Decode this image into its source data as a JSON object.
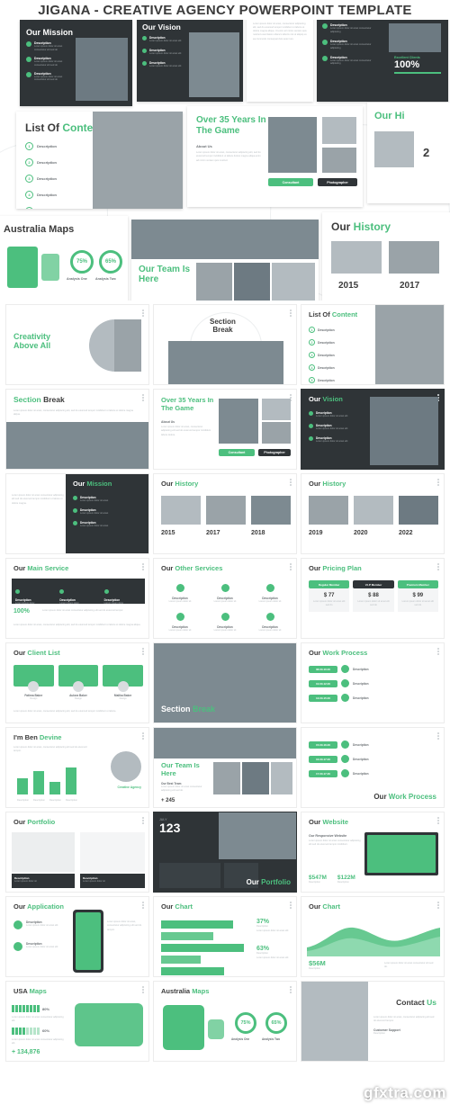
{
  "banner": {
    "title": "JIGANA - CREATIVE AGENCY POWERPOINT TEMPLATE"
  },
  "watermark": "gfxtra.com",
  "hero": {
    "slides": [
      {
        "title_plain": "Our ",
        "title_green": "Mission",
        "desc_label": "Description"
      },
      {
        "title_plain": "Our ",
        "title_green": "Vision",
        "desc_label": "Description"
      },
      {
        "title_plain": "Description",
        "stat_label": "Excellent Clients",
        "stat_value": "100%"
      },
      {
        "title_plain": "List Of ",
        "title_green": "Content",
        "desc_label": "Description"
      },
      {
        "title_plain": "Over 35 Years In",
        "title_line2": "The Game",
        "about_label": "About Us",
        "tag1": "Consultant",
        "tag2": "Photographer"
      },
      {
        "title_plain": "Our Hi",
        "year": "2"
      },
      {
        "title_plain": "Australia Maps",
        "ring1": "75%",
        "ring1_label": "Analysis One",
        "ring2": "65%",
        "ring2_label": "Analysis Two"
      },
      {
        "title_plain": "Our Team Is",
        "title_line2": "Here"
      },
      {
        "title_plain": "Our ",
        "title_green": "History",
        "year1": "2015",
        "year2": "2017"
      }
    ]
  },
  "grid": {
    "slides": [
      {
        "id": "creativity-above-all",
        "title": "Creativity",
        "title2": "Above All",
        "style": "light-green-title"
      },
      {
        "id": "section-break-1",
        "title": "Section",
        "title2": "Break",
        "style": "centered"
      },
      {
        "id": "list-of-content-1",
        "title": "List Of ",
        "title_green": "Content",
        "items": [
          "Description",
          "Description",
          "Description",
          "Description",
          "Description"
        ]
      },
      {
        "id": "section-break-2",
        "title": "Section ",
        "title_green": "Break"
      },
      {
        "id": "over-35-years",
        "title": "Over 35 Years In",
        "title2": "The Game",
        "about_label": "About Us",
        "tag1": "Consultant",
        "tag2": "Photographer"
      },
      {
        "id": "our-vision",
        "title": "Our ",
        "title_green": "Vision",
        "desc_label": "Description"
      },
      {
        "id": "our-mission",
        "title": "Our ",
        "title_green": "Mission",
        "desc_label": "Description"
      },
      {
        "id": "our-history-1",
        "title": "Our ",
        "title_green": "History",
        "years": [
          "2015",
          "2017",
          "2018"
        ]
      },
      {
        "id": "our-history-2",
        "title": "Our ",
        "title_green": "History",
        "years": [
          "2019",
          "2020",
          "2022"
        ]
      },
      {
        "id": "our-main-service",
        "title": "Our ",
        "title_green": "Main Service",
        "stat": "100%",
        "cols": [
          "Description",
          "Description",
          "Description"
        ]
      },
      {
        "id": "our-other-services",
        "title": "Our ",
        "title_green": "Other Services",
        "items": [
          "Description",
          "Description",
          "Description",
          "Description",
          "Description",
          "Description"
        ]
      },
      {
        "id": "our-pricing-plan",
        "title": "Our ",
        "title_green": "Pricing Plan",
        "plans": [
          {
            "name": "Regular Member",
            "price": "$ 77"
          },
          {
            "name": "V.I.P Member",
            "price": "$ 88"
          },
          {
            "name": "Premium Member",
            "price": "$ 99"
          }
        ]
      },
      {
        "id": "our-client-list",
        "title": "Our ",
        "title_green": "Client List",
        "people": [
          {
            "name": "Fatima Baker",
            "role": "Design"
          },
          {
            "name": "Aulora Baker",
            "role": "Design"
          },
          {
            "name": "Malika Baker",
            "role": "Design"
          }
        ]
      },
      {
        "id": "section-break-3",
        "title": "Section ",
        "title_green": "Break"
      },
      {
        "id": "our-work-process-1",
        "title": "Our ",
        "title_green": "Work Process",
        "times": [
          "08.00-10.00",
          "10.00-12.00",
          "13.00-15.00"
        ],
        "labels": [
          "Description",
          "Description",
          "Description"
        ]
      },
      {
        "id": "im-ben-devine",
        "title": "I'm Ben ",
        "title_green": "Devine",
        "sub": "Creative Agency",
        "chart_label": "Description"
      },
      {
        "id": "our-team-is-here",
        "title": "Our Team Is",
        "title2": "Here",
        "about_label": "Our Best Team",
        "count": "+ 245"
      },
      {
        "id": "our-work-process-2",
        "title": "Our ",
        "title_green": "Work Process",
        "times": [
          "15.00-16.00",
          "16.00-17.00",
          "17.00-17.30"
        ],
        "labels": [
          "Description",
          "Description",
          "Description"
        ]
      },
      {
        "id": "our-portfolio-1",
        "title": "Our ",
        "title_green": "Portfolio",
        "cap1": "Description",
        "cap2": "Description"
      },
      {
        "id": "our-portfolio-2",
        "title": "Our ",
        "title_green": "Portfolio",
        "big": "123",
        "sub": "JULY"
      },
      {
        "id": "our-website",
        "title": "Our ",
        "title_green": "Website",
        "sub": "Our Responsive Website",
        "stat1": "$547M",
        "stat1_label": "Description",
        "stat2": "$122M",
        "stat2_label": "Description"
      },
      {
        "id": "our-application",
        "title": "Our ",
        "title_green": "Application",
        "desc_label": "Description"
      },
      {
        "id": "our-chart-1",
        "title": "Our ",
        "title_green": "Chart",
        "stat1": "37%",
        "stat1_label": "Description",
        "stat2": "63%",
        "stat2_label": "Description"
      },
      {
        "id": "our-chart-2",
        "title": "Our ",
        "title_green": "Chart",
        "stat": "$56M",
        "stat_label": "Description"
      },
      {
        "id": "usa-maps",
        "title": "USA ",
        "title_green": "Maps",
        "p1": "80%",
        "p2": "60%",
        "big": "+ 134,876"
      },
      {
        "id": "australia-maps",
        "title": "Australia ",
        "title_green": "Maps",
        "ring1": "75%",
        "ring1_label": "Analysis One",
        "ring2": "65%",
        "ring2_label": "Analysis Two"
      },
      {
        "id": "contact-us",
        "title": "Contact ",
        "title_green": "Us",
        "sub": "Customer Support",
        "phone": "Description"
      }
    ]
  }
}
